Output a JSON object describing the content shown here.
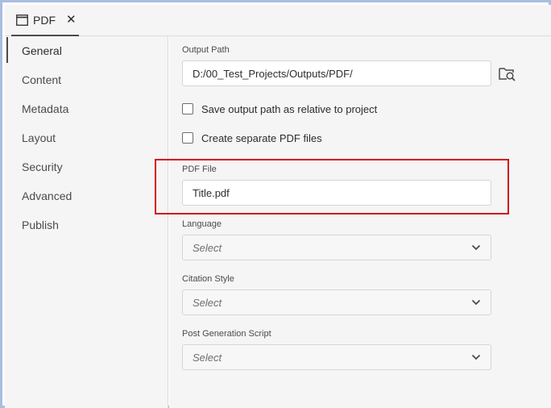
{
  "tab": {
    "label": "PDF",
    "close_glyph": "✕"
  },
  "sidebar": {
    "items": [
      {
        "label": "General",
        "active": true
      },
      {
        "label": "Content"
      },
      {
        "label": "Metadata"
      },
      {
        "label": "Layout"
      },
      {
        "label": "Security"
      },
      {
        "label": "Advanced"
      },
      {
        "label": "Publish"
      }
    ]
  },
  "main": {
    "output_path": {
      "label": "Output Path",
      "value": "D:/00_Test_Projects/Outputs/PDF/"
    },
    "checkboxes": {
      "relative": {
        "label": "Save output path as relative to project",
        "checked": false
      },
      "separate": {
        "label": "Create separate PDF files",
        "checked": false
      }
    },
    "pdf_file": {
      "label": "PDF File",
      "value": "Title.pdf"
    },
    "language": {
      "label": "Language",
      "value": "Select"
    },
    "citation_style": {
      "label": "Citation Style",
      "value": "Select"
    },
    "post_script": {
      "label": "Post Generation Script",
      "value": "Select"
    }
  },
  "colors": {
    "frame_border": "#a9bde0",
    "highlight": "#d40f14",
    "panel_bg": "#f5f5f5"
  }
}
